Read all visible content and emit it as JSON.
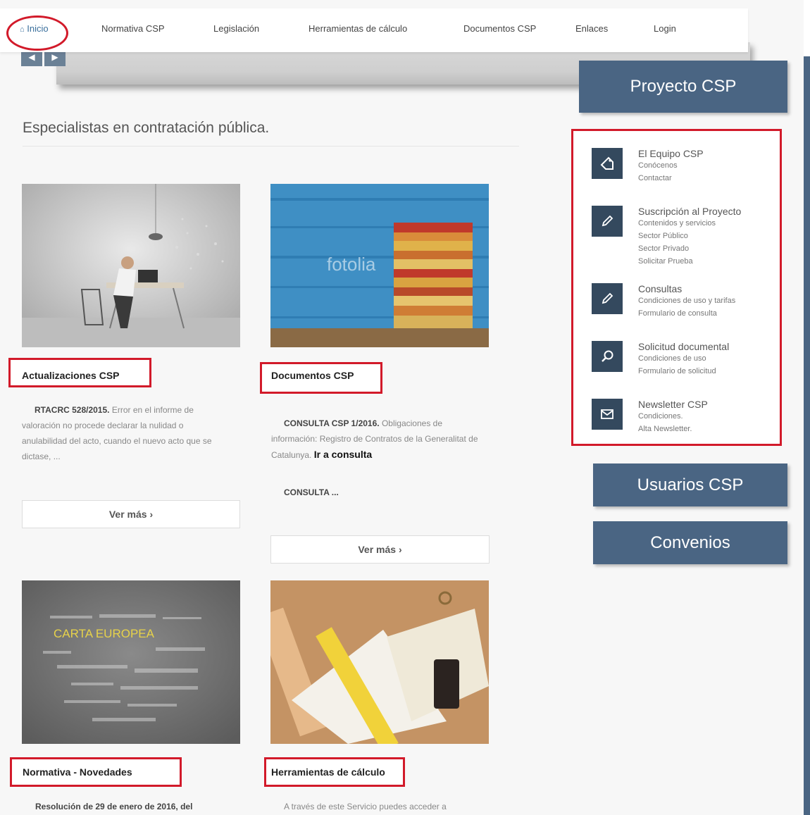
{
  "nav": {
    "home": "Inicio",
    "items": [
      "Normativa CSP",
      "Legislación",
      "Herramientas de cálculo",
      "Documentos CSP",
      "Enlaces",
      "Login"
    ]
  },
  "main": {
    "tagline": "Especialistas en contratación pública.",
    "cards": [
      {
        "title": "Actualizaciones CSP",
        "lead": "RTACRC 528/2015.",
        "text": "Error en el informe de valoración no procede declarar la nulidad o anulabilidad del acto, cuando el nuevo acto que se dictase, ...",
        "more": "Ver más ›"
      },
      {
        "title": "Documentos CSP",
        "lead": "CONSULTA CSP 1/2016.",
        "text": "Obligaciones de información: Registro de Contratos de la Generalitat de Catalunya.",
        "link": "Ir a consulta",
        "extra": "CONSULTA ...",
        "more": "Ver más ›"
      },
      {
        "title": "Normativa - Novedades",
        "lead": "Resolución de 29 de enero de 2016, del"
      },
      {
        "title": "Herramientas de cálculo",
        "text": "A través de este Servicio puedes acceder a"
      }
    ],
    "image_watermark": "fotolia",
    "wordcloud_word": "CARTA EUROPEA"
  },
  "sidebar": {
    "proyecto": "Proyecto CSP",
    "usuarios": "Usuarios CSP",
    "convenios": "Convenios",
    "items": [
      {
        "title": "El Equipo CSP",
        "subs": [
          "Conócenos",
          "Contactar"
        ],
        "icon": "tag-icon"
      },
      {
        "title": "Suscripción al Proyecto",
        "subs": [
          "Contenidos y servicios",
          "Sector Público",
          "Sector Privado",
          "Solicitar Prueba"
        ],
        "icon": "pencil-icon"
      },
      {
        "title": "Consultas",
        "subs": [
          "Condiciones de uso y tarifas",
          "Formulario de consulta"
        ],
        "icon": "pencil-icon"
      },
      {
        "title": "Solicitud documental",
        "subs": [
          "Condiciones de uso",
          "Formulario de solicitud"
        ],
        "icon": "search-icon"
      },
      {
        "title": "Newsletter CSP",
        "subs": [
          "Condiciones.",
          "Alta Newsletter."
        ],
        "icon": "envelope-icon"
      }
    ]
  },
  "colors": {
    "accent": "#4a6583",
    "highlight": "#d21a2a"
  }
}
